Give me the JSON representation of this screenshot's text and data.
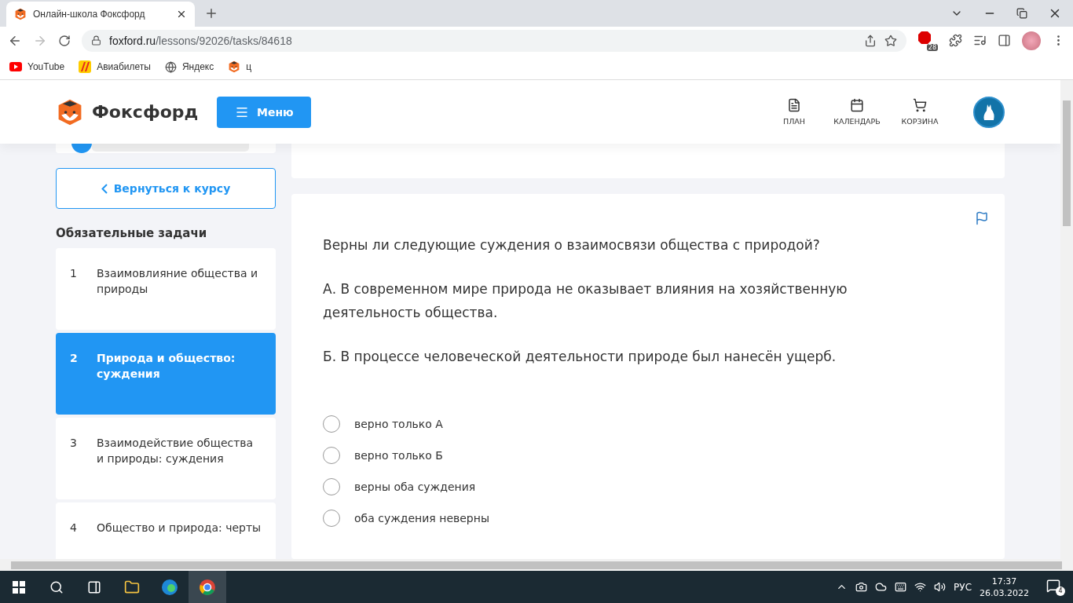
{
  "browser": {
    "tab_title": "Онлайн-школа Фоксфорд",
    "url_host": "foxford.ru",
    "url_path": "/lessons/92026/tasks/84618",
    "extension_badge": "28",
    "bookmarks": [
      {
        "label": "YouTube",
        "kind": "youtube"
      },
      {
        "label": "Авиабилеты",
        "kind": "avia"
      },
      {
        "label": "Яндекс",
        "kind": "globe"
      },
      {
        "label": "ц",
        "kind": "fox"
      }
    ]
  },
  "header": {
    "brand": "Фоксфорд",
    "menu_button": "Меню",
    "nav": [
      {
        "label": "ПЛАН",
        "kind": "plan"
      },
      {
        "label": "КАЛЕНДАРЬ",
        "kind": "calendar"
      },
      {
        "label": "КОРЗИНА",
        "kind": "cart"
      }
    ]
  },
  "sidebar": {
    "back_button": "Вернуться к курсу",
    "section_title": "Обязательные задачи",
    "tasks": [
      {
        "number": "1",
        "title": "Взаимовлияние общества и природы",
        "selected": false
      },
      {
        "number": "2",
        "title": "Природа и общество: суждения",
        "selected": true
      },
      {
        "number": "3",
        "title": "Взаимодействие общества и природы: суждения",
        "selected": false
      },
      {
        "number": "4",
        "title": "Общество и природа: черты",
        "selected": false
      }
    ]
  },
  "task": {
    "paragraphs": [
      "Верны ли следующие суждения о взаимосвязи общества с природой?",
      "А. В современном мире природа не оказывает влияния на хозяйственную деятельность общества.",
      "Б. В процессе человеческой деятельности природе был нанесён ущерб."
    ],
    "options": [
      {
        "label": "верно только А",
        "selected": false
      },
      {
        "label": "верно только Б",
        "selected": false
      },
      {
        "label": "верны оба суждения",
        "selected": false
      },
      {
        "label": "оба суждения неверны",
        "selected": false
      }
    ]
  },
  "taskbar": {
    "language": "РУС",
    "time": "17:37",
    "date": "26.03.2022",
    "notifications": "4"
  }
}
